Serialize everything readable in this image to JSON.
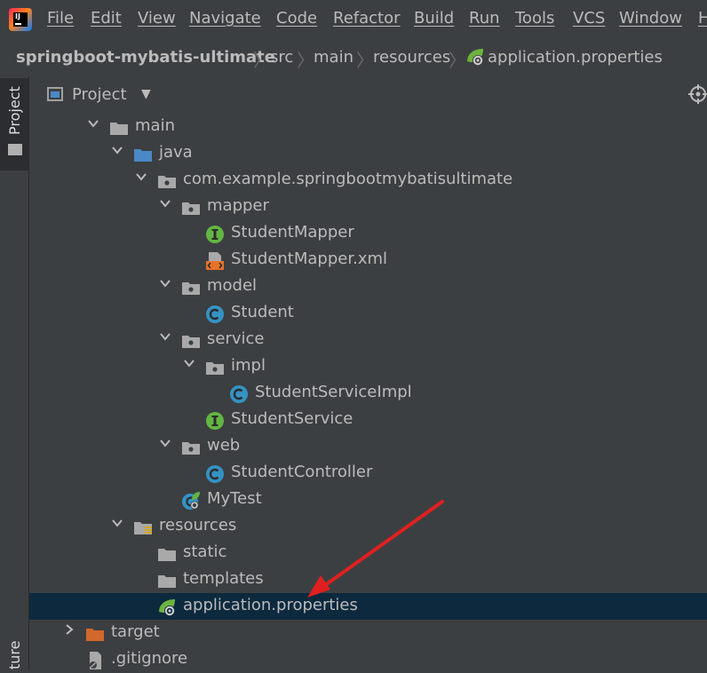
{
  "menu": [
    "File",
    "Edit",
    "View",
    "Navigate",
    "Code",
    "Refactor",
    "Build",
    "Run",
    "Tools",
    "VCS",
    "Window",
    "H"
  ],
  "app_logo_text": "IJ",
  "breadcrumb": [
    "springboot-mybatis-ultimate",
    "src",
    "main",
    "resources",
    "application.properties"
  ],
  "sidebar_tab": "Project",
  "sidebar_bottom_tab": "ture",
  "tool_window": {
    "title": "Project"
  },
  "tree": [
    {
      "label": "main",
      "icon": "folder-icon",
      "expand": "down"
    },
    {
      "label": "java",
      "icon": "source-folder-icon",
      "expand": "down"
    },
    {
      "label": "com.example.springbootmybatisultimate",
      "icon": "package-icon",
      "expand": "down"
    },
    {
      "label": "mapper",
      "icon": "package-icon",
      "expand": "down"
    },
    {
      "label": "StudentMapper",
      "icon": "interface-icon",
      "expand": ""
    },
    {
      "label": "StudentMapper.xml",
      "icon": "xml-file-icon",
      "expand": ""
    },
    {
      "label": "model",
      "icon": "package-icon",
      "expand": "down"
    },
    {
      "label": "Student",
      "icon": "class-icon",
      "expand": ""
    },
    {
      "label": "service",
      "icon": "package-icon",
      "expand": "down"
    },
    {
      "label": "impl",
      "icon": "package-icon",
      "expand": "down"
    },
    {
      "label": "StudentServiceImpl",
      "icon": "class-icon",
      "expand": ""
    },
    {
      "label": "StudentService",
      "icon": "interface-icon",
      "expand": ""
    },
    {
      "label": "web",
      "icon": "package-icon",
      "expand": "down"
    },
    {
      "label": "StudentController",
      "icon": "class-icon",
      "expand": ""
    },
    {
      "label": "MyTest",
      "icon": "spring-boot-class-icon",
      "expand": ""
    },
    {
      "label": "resources",
      "icon": "resources-folder-icon",
      "expand": "down"
    },
    {
      "label": "static",
      "icon": "folder-icon",
      "expand": ""
    },
    {
      "label": "templates",
      "icon": "folder-icon",
      "expand": ""
    },
    {
      "label": "application.properties",
      "icon": "spring-properties-icon",
      "expand": "",
      "selected": true
    },
    {
      "label": "target",
      "icon": "excluded-folder-icon",
      "expand": "right"
    },
    {
      "label": ".gitignore",
      "icon": "gitignore-file-icon",
      "expand": ""
    }
  ],
  "colors": {
    "background": "#3c3f41",
    "selection": "#0d293e",
    "text": "#bbbbbb",
    "annotation_arrow": "#e02020"
  }
}
